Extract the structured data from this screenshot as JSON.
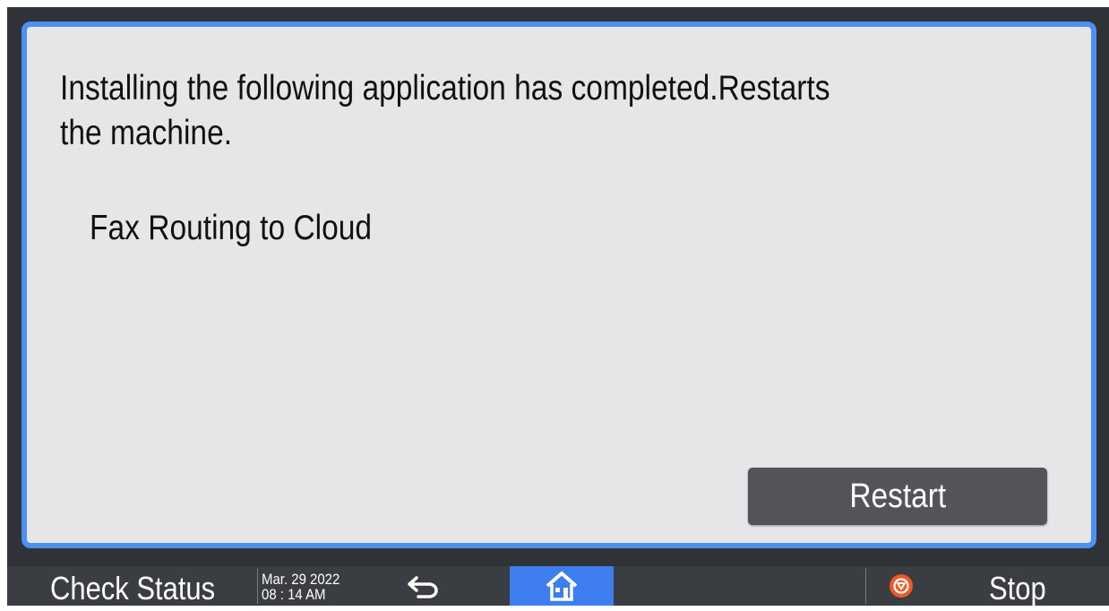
{
  "dialog": {
    "message": "Installing the following application has completed.Restarts the machine.",
    "application_name": "Fax Routing to Cloud",
    "restart_label": "Restart"
  },
  "taskbar": {
    "check_status_label": "Check Status",
    "date": "Mar. 29 2022",
    "time": "08 : 14 AM",
    "stop_label": "Stop",
    "icons": {
      "back": "back-arrow-icon",
      "home": "home-icon",
      "stop": "stop-icon"
    }
  },
  "colors": {
    "dialog_border": "#4f8ff0",
    "dialog_bg": "#e6e6e8",
    "button_bg": "#535457",
    "taskbar_bg": "#3a3d41",
    "home_active": "#3e7ef0",
    "stop_icon": "#f05a28"
  }
}
